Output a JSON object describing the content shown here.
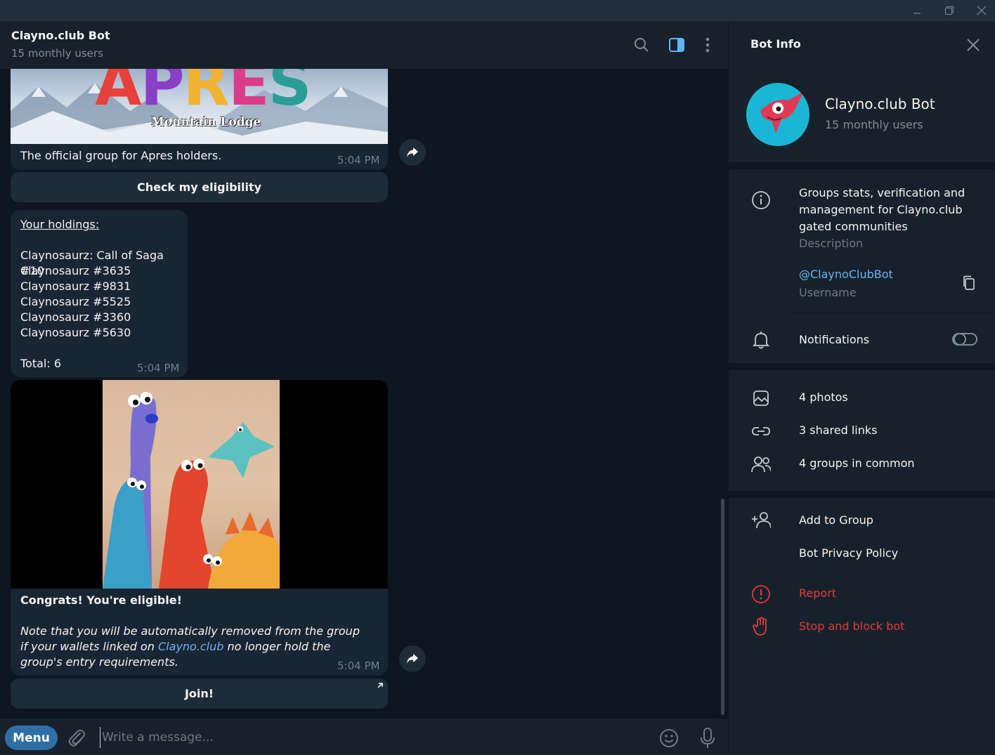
{
  "chat": {
    "title": "Clayno.club Bot",
    "subtitle": "15 monthly users"
  },
  "messages": {
    "apres": {
      "banner_text": "APRES",
      "banner_sub": "Mountain Lodge",
      "caption": "The official group for Apres holders.",
      "time": "5:04 PM",
      "button": "Check my eligibility"
    },
    "holdings": {
      "heading": "Your holdings:",
      "items": [
        "Claynosaurz: Call of Saga #10",
        "Claynosaurz #3635",
        "Claynosaurz #9831",
        "Claynosaurz #5525",
        "Claynosaurz #3360",
        "Claynosaurz #5630"
      ],
      "total": "Total: 6",
      "time": "5:04 PM"
    },
    "eligible": {
      "title": "Congrats! You're eligible!",
      "note_before": "Note that you will be automatically removed from the group if your wallets linked on ",
      "note_link": "Clayno.club",
      "note_after": " no longer hold the group's entry requirements.",
      "time": "5:04 PM",
      "button": "Join!"
    }
  },
  "composer": {
    "menu_label": "Menu",
    "placeholder": "Write a message..."
  },
  "panel": {
    "title": "Bot Info",
    "bot_name": "Clayno.club Bot",
    "bot_sub": "15 monthly users",
    "description": "Groups stats, verification and management for Clayno.club gated communities",
    "description_label": "Description",
    "username": "@ClaynoClubBot",
    "username_label": "Username",
    "notifications": "Notifications",
    "notifications_on": false,
    "photos": "4 photos",
    "links": "3 shared links",
    "groups": "4 groups in common",
    "add_to_group": "Add to Group",
    "privacy": "Bot Privacy Policy",
    "report": "Report",
    "block": "Stop and block bot"
  },
  "colors": {
    "accent": "#6ab3f3",
    "danger": "#e53935",
    "avatar_bg": "#1bb6d6"
  }
}
